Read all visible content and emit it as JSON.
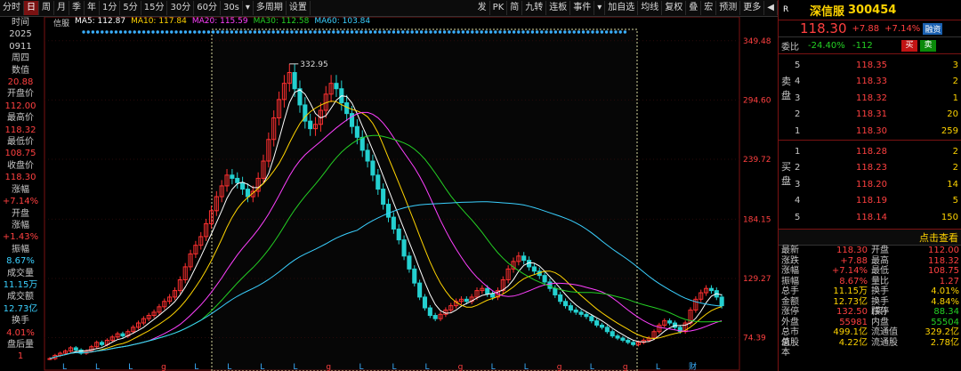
{
  "toolbar": {
    "left_items": [
      "分时",
      "日",
      "周",
      "月",
      "季",
      "年",
      "1分",
      "5分",
      "15分",
      "30分",
      "60分",
      "30s",
      "▾",
      "多周期",
      "设置"
    ],
    "active_item": "日",
    "right_items": [
      "发",
      "PK",
      "简",
      "九转",
      "连板",
      "事件",
      "▾",
      "加自选",
      "均线",
      "复权",
      "叠",
      "宏",
      "预测",
      "更多",
      "◀"
    ]
  },
  "ma_legend": {
    "prefix": "信服",
    "items": [
      {
        "label": "MA5: 112.87",
        "color": "#ffffff"
      },
      {
        "label": "MA10: 117.84",
        "color": "#ffd400"
      },
      {
        "label": "MA20: 115.59",
        "color": "#ff40ff"
      },
      {
        "label": "MA30: 112.58",
        "color": "#24d024"
      },
      {
        "label": "MA60: 103.84",
        "color": "#3ad0ff"
      }
    ]
  },
  "left_panel": {
    "rows": [
      {
        "label": "时间",
        "value": "2025",
        "value2": "0911",
        "value3": "周四"
      },
      {
        "label": "数值",
        "value": "20.88"
      },
      {
        "label": "开盘价",
        "value": "112.00"
      },
      {
        "label": "最高价",
        "value": "118.32"
      },
      {
        "label": "最低价",
        "value": "108.75"
      },
      {
        "label": "收盘价",
        "value": "118.30"
      },
      {
        "label": "涨幅",
        "value": "+7.14%"
      },
      {
        "label": "开盘",
        "label2": "涨幅",
        "value": "+1.43%"
      },
      {
        "label": "振幅",
        "value": "8.67%"
      },
      {
        "label": "成交量",
        "value": "11.15万"
      },
      {
        "label": "成交额",
        "value": "12.73亿"
      },
      {
        "label": "换手",
        "value": "4.01%"
      },
      {
        "label": "盘后量",
        "value": "1"
      }
    ]
  },
  "chart_data": {
    "type": "candlestick",
    "y_ticks": [
      "349.48",
      "294.60",
      "239.72",
      "184.15",
      "129.27",
      "74.39"
    ],
    "ylim": [
      60,
      360
    ],
    "annotation_high": "332.95",
    "close_series": [
      55,
      58,
      60,
      62,
      65,
      63,
      60,
      62,
      66,
      70,
      68,
      72,
      75,
      78,
      76,
      80,
      84,
      88,
      92,
      95,
      98,
      103,
      108,
      112,
      118,
      128,
      140,
      152,
      160,
      168,
      180,
      192,
      205,
      215,
      225,
      222,
      218,
      212,
      205,
      210,
      222,
      238,
      258,
      278,
      295,
      310,
      320,
      305,
      290,
      275,
      268,
      272,
      285,
      300,
      310,
      305,
      292,
      282,
      270,
      260,
      248,
      238,
      225,
      212,
      198,
      186,
      175,
      165,
      150,
      138,
      125,
      112,
      102,
      95,
      92,
      96,
      100,
      104,
      108,
      110,
      108,
      112,
      118,
      120,
      115,
      112,
      118,
      128,
      138,
      145,
      150,
      146,
      140,
      136,
      132,
      126,
      120,
      114,
      108,
      104,
      100,
      98,
      96,
      94,
      90,
      86,
      84,
      80,
      76,
      74,
      72,
      70,
      68,
      70,
      72,
      74,
      80,
      86,
      90,
      88,
      84,
      80,
      88,
      100,
      110,
      116,
      120,
      118,
      112,
      104
    ],
    "ma_series_colors": [
      "#ffffff",
      "#ffd400",
      "#ff40ff",
      "#24d024",
      "#3ad0ff"
    ],
    "bottom_markers": [
      "L",
      "L",
      "L",
      "g",
      "L",
      "L",
      "L",
      "L",
      "g",
      "L",
      "L",
      "L",
      "g",
      "L",
      "L",
      "g",
      "L",
      "g",
      "L",
      "财"
    ]
  },
  "right_panel": {
    "title_prefix": "R",
    "name": "深信服",
    "code": "300454",
    "price": "118.30",
    "change": "+7.88",
    "pct": "+7.14%",
    "badge": "融资",
    "ratio_label": "委比",
    "ratio_pct": "-24.40%",
    "ratio_diff": "-112",
    "buy_btn": "买",
    "sell_btn": "卖",
    "sell_side_label": "卖盘",
    "buy_side_label": "买盘",
    "asks": [
      {
        "level": "5",
        "price": "118.35",
        "vol": "3"
      },
      {
        "level": "4",
        "price": "118.33",
        "vol": "2"
      },
      {
        "level": "3",
        "price": "118.32",
        "vol": "1"
      },
      {
        "level": "2",
        "price": "118.31",
        "vol": "20"
      },
      {
        "level": "1",
        "price": "118.30",
        "vol": "259"
      }
    ],
    "bids": [
      {
        "level": "1",
        "price": "118.28",
        "vol": "2"
      },
      {
        "level": "2",
        "price": "118.23",
        "vol": "2"
      },
      {
        "level": "3",
        "price": "118.20",
        "vol": "14"
      },
      {
        "level": "4",
        "price": "118.19",
        "vol": "5"
      },
      {
        "level": "5",
        "price": "118.14",
        "vol": "150"
      }
    ],
    "click_label": "点击查看",
    "stats": [
      {
        "k": "最新",
        "v": "118.30",
        "vc": "red",
        "k2": "开盘",
        "v2": "112.00",
        "v2c": "red"
      },
      {
        "k": "涨跌",
        "v": "+7.88",
        "vc": "red",
        "k2": "最高",
        "v2": "118.32",
        "v2c": "red"
      },
      {
        "k": "涨幅",
        "v": "+7.14%",
        "vc": "red",
        "k2": "最低",
        "v2": "108.75",
        "v2c": "red"
      },
      {
        "k": "振幅",
        "v": "8.67%",
        "vc": "red",
        "k2": "量比",
        "v2": "1.27",
        "v2c": "red"
      },
      {
        "k": "总手",
        "v": "11.15万",
        "vc": "ylw",
        "k2": "换手",
        "v2": "4.01%",
        "v2c": "ylw"
      },
      {
        "k": "金额",
        "v": "12.73亿",
        "vc": "ylw",
        "k2": "换手(实)",
        "v2": "4.84%",
        "v2c": "ylw"
      },
      {
        "k": "涨停",
        "v": "132.50",
        "vc": "red",
        "k2": "跌停",
        "v2": "88.34",
        "v2c": "grn"
      },
      {
        "k": "外盘",
        "v": "55981",
        "vc": "red",
        "k2": "内盘",
        "v2": "55504",
        "v2c": "grn"
      },
      {
        "k": "总市值",
        "v": "499.1亿",
        "vc": "ylw",
        "k2": "流通值",
        "v2": "329.2亿",
        "v2c": "ylw"
      },
      {
        "k": "总股本",
        "v": "4.22亿",
        "vc": "ylw",
        "k2": "流通股",
        "v2": "2.78亿",
        "v2c": "ylw"
      }
    ]
  }
}
